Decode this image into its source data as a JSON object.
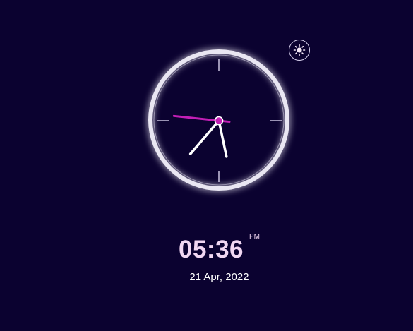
{
  "theme_toggle": {
    "icon": "sun-icon"
  },
  "clock": {
    "time": {
      "hours": 5,
      "minutes": 36,
      "seconds": 46
    },
    "ring_color": "#e9e6f2",
    "second_hand_color": "#c21fb5",
    "hand_color": "#ffffff",
    "tick_color": "#d9d2ee"
  },
  "digital": {
    "time": "05:36",
    "ampm": "PM",
    "date": "21 Apr, 2022"
  },
  "colors": {
    "background": "#0b0230",
    "digital_time": "#f1d7f2"
  }
}
